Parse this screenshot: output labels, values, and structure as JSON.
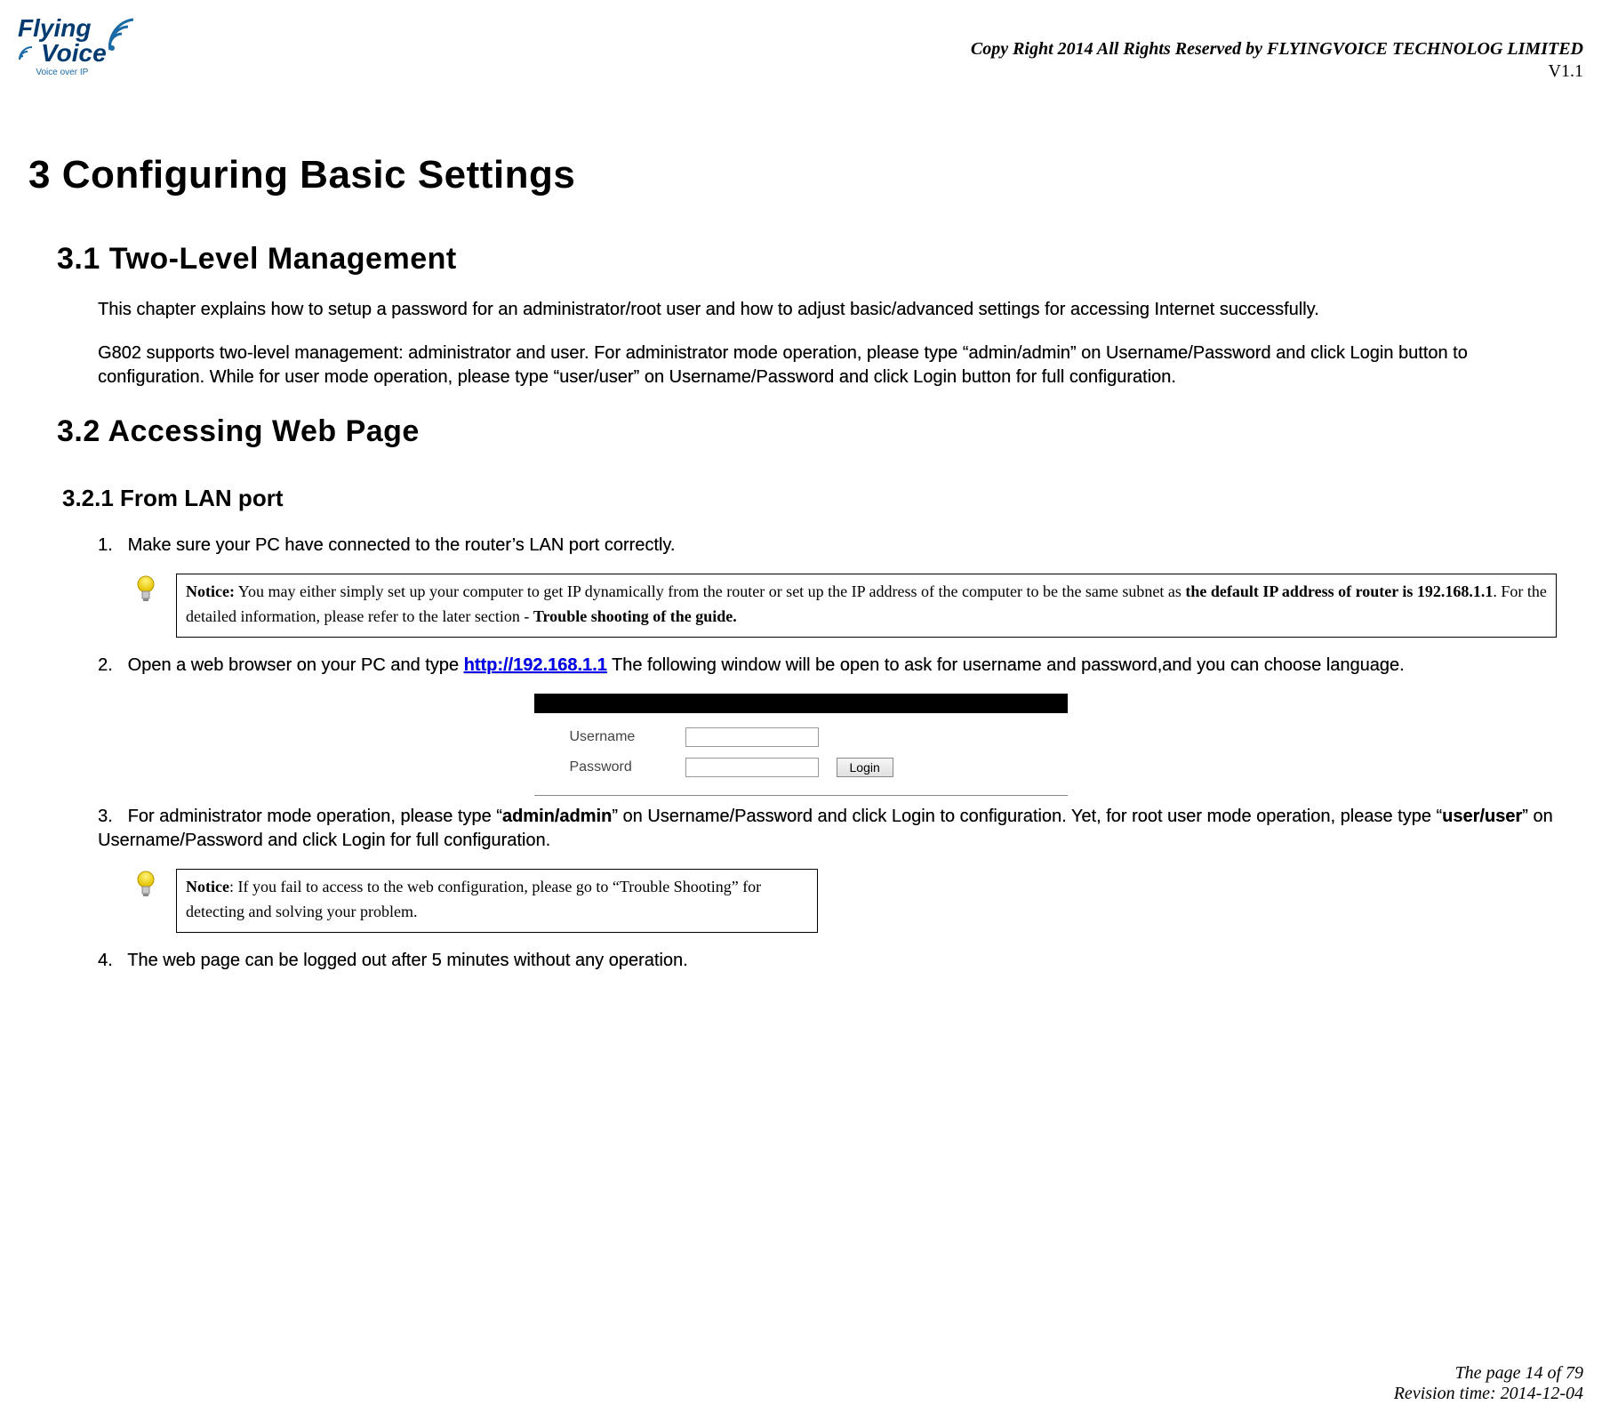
{
  "logo": {
    "line1": "Flying",
    "line2": "Voice",
    "tagline": "Voice over IP"
  },
  "header": {
    "copyright": "Copy Right 2014 All Rights Reserved by FLYINGVOICE TECHNOLOG LIMITED",
    "version": "V1.1"
  },
  "h1": "3 Configuring Basic Settings",
  "s31": {
    "title": "3.1 Two-Level Management",
    "p1": "This chapter explains how to setup a password for an administrator/root user and how to adjust basic/advanced settings for accessing Internet successfully.",
    "p2": "G802 supports two-level management: administrator and user. For administrator mode operation, please type “admin/admin” on Username/Password and click Login button to configuration. While for user mode operation, please type “user/user” on Username/Password and click Login button for full configuration."
  },
  "s32": {
    "title": "3.2 Accessing Web Page",
    "s321_title": "3.2.1 From LAN port",
    "step1_num": "1.",
    "step1": "Make sure your PC have connected to the router’s LAN port correctly.",
    "notice1_label": "Notice:",
    "notice1_a": " You may either simply set up your computer to get IP dynamically from the router or set up the IP address of the computer to be the same subnet as ",
    "notice1_bold": "the default IP address of router is 192.168.1.1",
    "notice1_b": ". For the detailed information, please refer to the later section - ",
    "notice1_bold2": "Trouble shooting of the guide",
    "step2_num": "2.",
    "step2_a": "Open a web browser on your PC and type ",
    "step2_link": "http://192.168.1.1",
    "step2_b": " The following window will be open to ask for username and password,and you can choose language.",
    "login_fig": {
      "username_label": "Username",
      "password_label": "Password",
      "login_btn": "Login"
    },
    "step3_num": "3.",
    "step3_a": "For administrator mode operation, please type “",
    "step3_bold1": "admin/admin",
    "step3_b": "” on Username/Password and click Login to configuration. Yet, for root user mode operation, please type “",
    "step3_bold2": "user/user",
    "step3_c": "” on Username/Password and click Login for full configuration.",
    "notice2_label": "Notice",
    "notice2_text": ": If you fail to access to the web configuration, please go to “Trouble Shooting” for detecting and solving your problem.",
    "step4_num": "4.",
    "step4": "The web page can be logged out after 5 minutes without any operation."
  },
  "footer": {
    "page": "The page 14 of 79",
    "revision": "Revision time: 2014-12-04"
  }
}
